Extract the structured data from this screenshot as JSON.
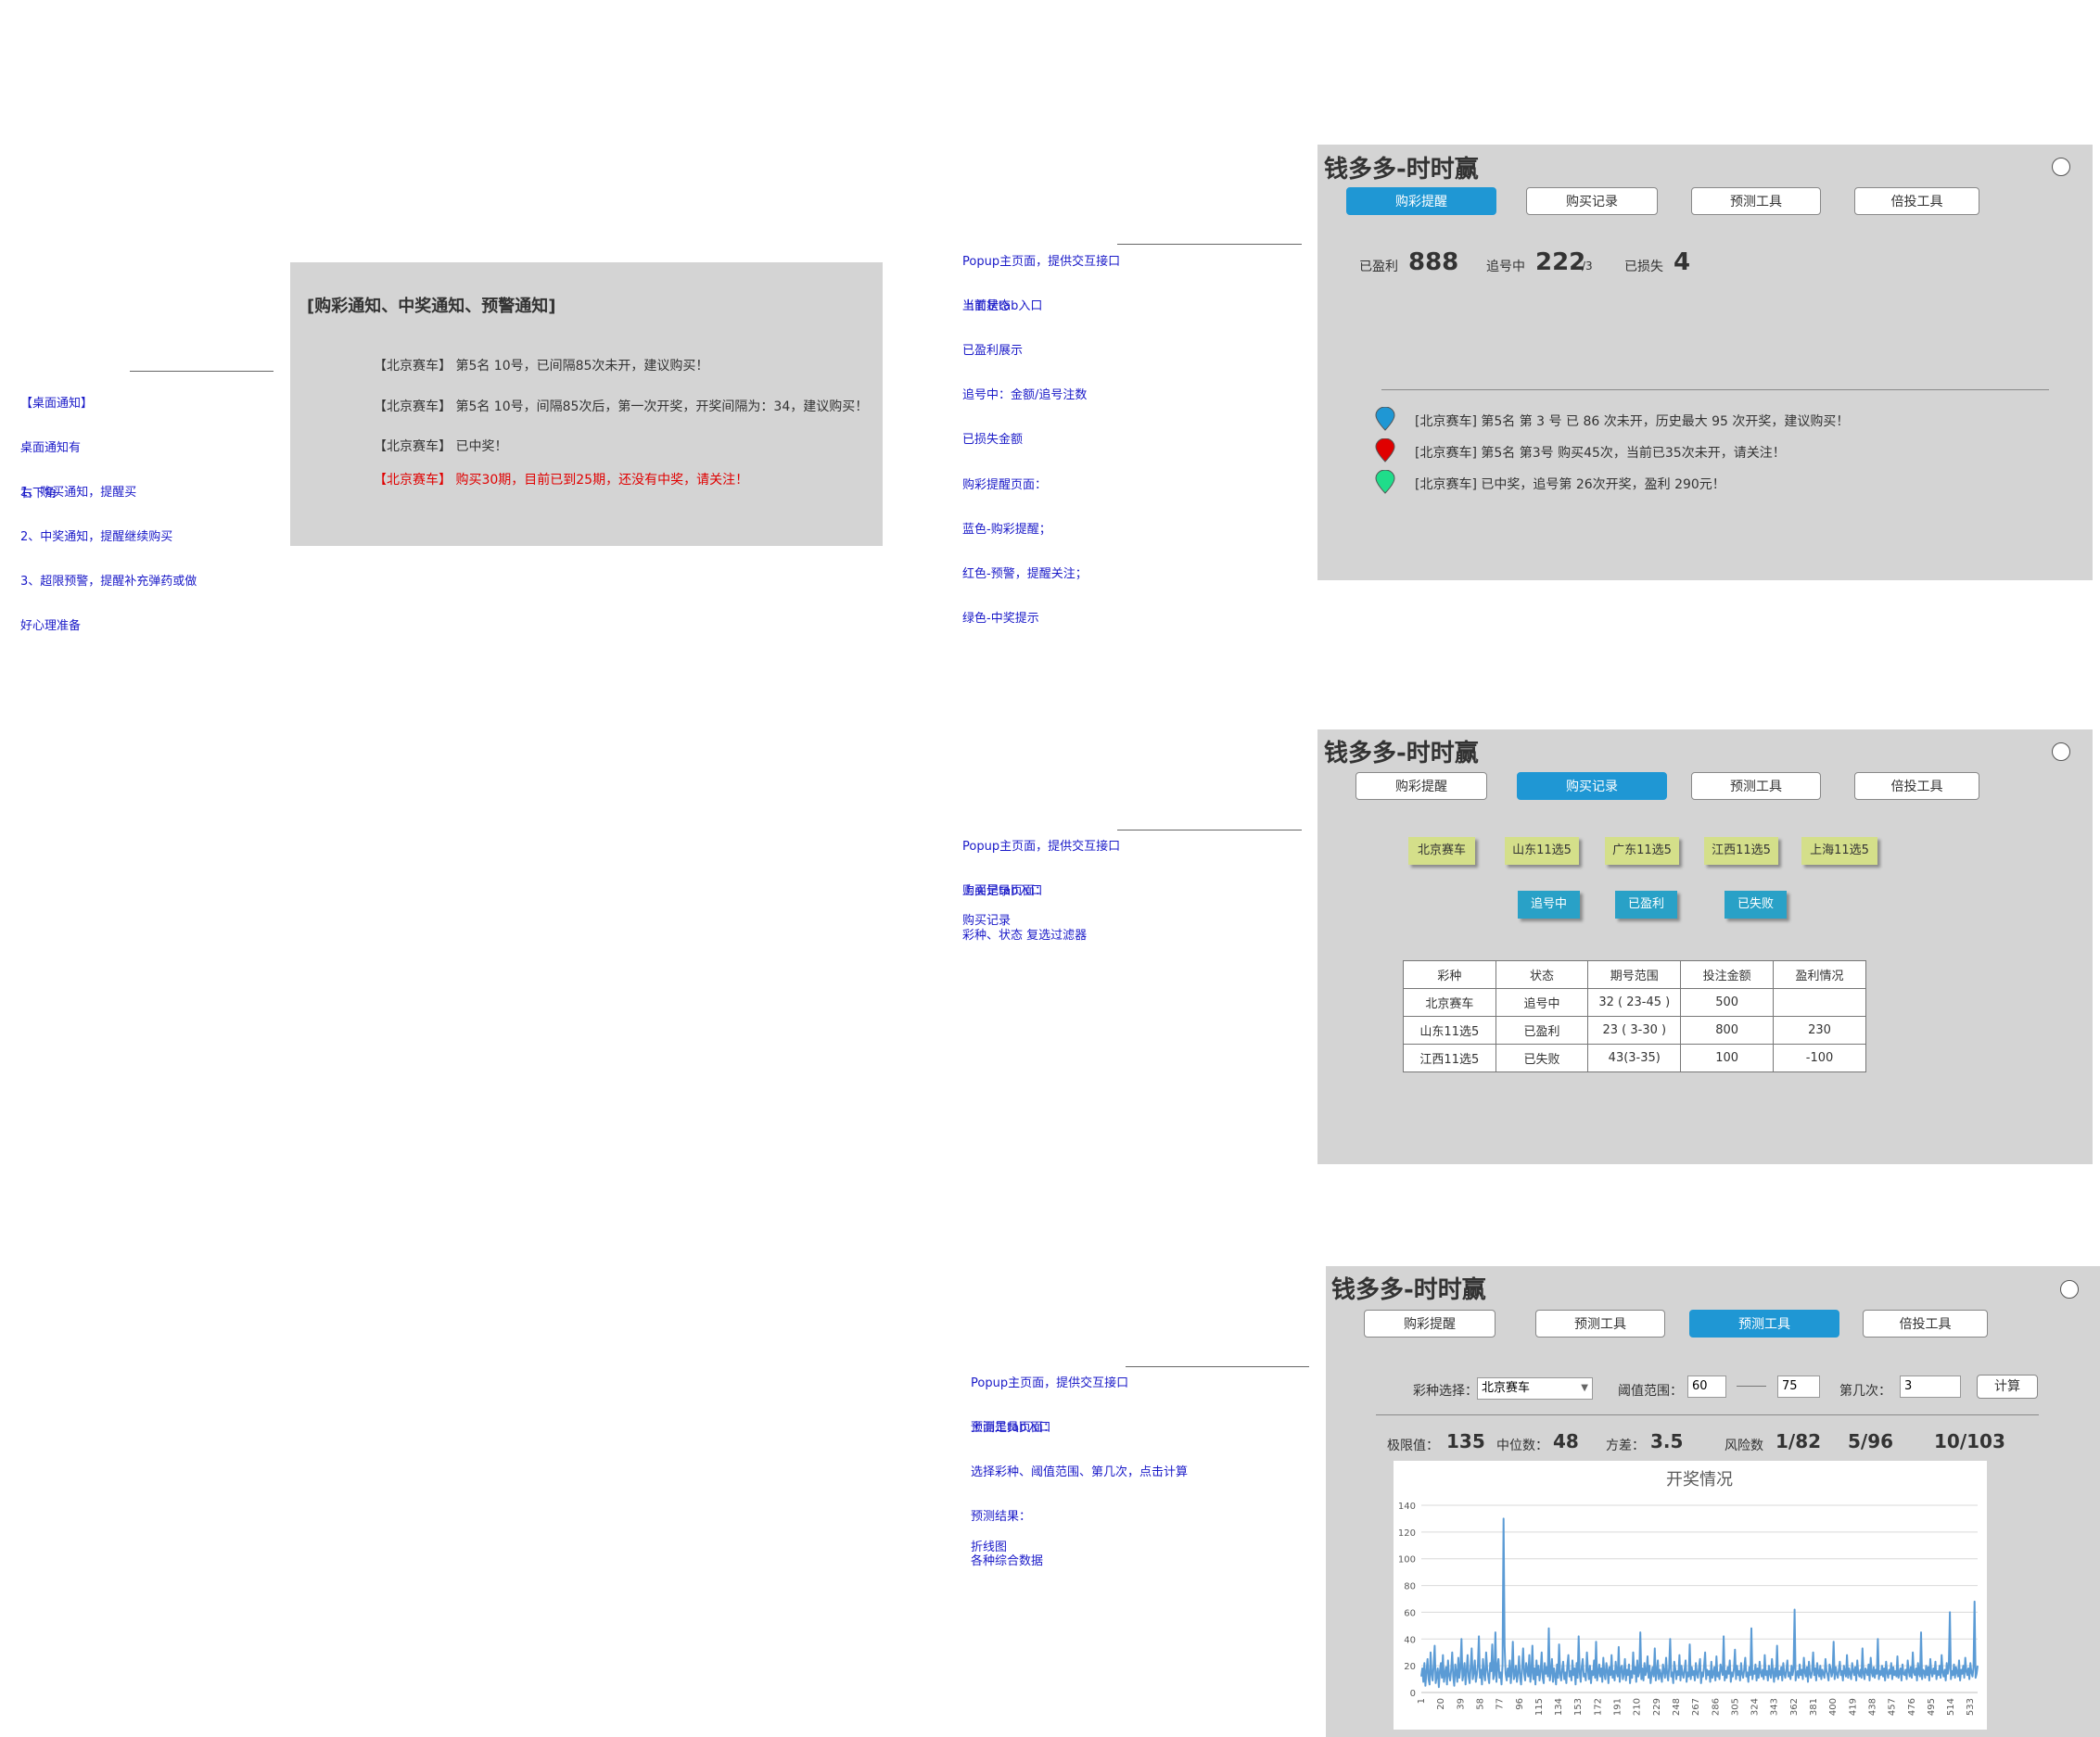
{
  "desktop_notes": {
    "lines": [
      "【桌面通知】",
      "桌面通知有",
      "1、购买通知，提醒买",
      "2、中奖通知，提醒继续购买",
      "3、超限预警，提醒补充弹药或做",
      "好心理准备"
    ],
    "corner": "右下角"
  },
  "notify_box": {
    "title": "[购彩通知、中奖通知、预警通知]",
    "messages": [
      "【北京赛车】 第5名 10号，已间隔85次未开，建议购买！",
      "【北京赛车】 第5名 10号，间隔85次后，第一次开奖，开奖间隔为：34，建议购买！",
      "【北京赛车】 已中奖！",
      "【北京赛车】 购买30期，目前已到25期，还没有中奖，请关注！"
    ]
  },
  "notes1": {
    "a": [
      "Popup主页面，提供交互接口",
      "上面是tab入口"
    ],
    "b": [
      "当前状态",
      "已盈利展示",
      "追号中：金额/追号注数",
      "已损失金额"
    ],
    "c": [
      "购彩提醒页面：",
      "蓝色-购彩提醒；",
      "红色-预警，提醒关注；",
      "绿色-中奖提示"
    ]
  },
  "notes2": {
    "a": [
      "Popup主页面，提供交互接口",
      "上面是tab入口"
    ],
    "b": [
      "购买记录页面：",
      "彩种、状态 复选过滤器"
    ],
    "c": "购买记录"
  },
  "notes3": {
    "a": [
      "Popup主页面，提供交互接口",
      "上面是tab入口"
    ],
    "b": [
      "预测工具页面：",
      "选择彩种、阈值范围、第几次，点击计算"
    ],
    "c": [
      "预测结果：",
      "各种综合数据"
    ],
    "d": "折线图"
  },
  "app_title": "钱多多-时时赢",
  "panel1": {
    "tabs": [
      "购彩提醒",
      "购买记录",
      "预测工具",
      "倍投工具"
    ],
    "stats": {
      "profit_label": "已盈利",
      "profit_value": "888",
      "chase_label": "追号中",
      "chase_value": "222",
      "chase_suffix": "/3",
      "loss_label": "已损失",
      "loss_value": "4"
    },
    "messages": [
      {
        "pin": "blue-pin-icon",
        "color": "#1f97d4",
        "text": "[北京赛车] 第5名 第 3 号 已 86 次未开，历史最大 95 次开奖，建议购买！"
      },
      {
        "pin": "red-pin-icon",
        "color": "#e00000",
        "text": "[北京赛车] 第5名 第3号 购买45次，当前已35次未开，请关注！"
      },
      {
        "pin": "green-pin-icon",
        "color": "#1fdd8a",
        "text": "[北京赛车] 已中奖，追号第 26次开奖，盈利 290元！"
      }
    ]
  },
  "panel2": {
    "tabs": [
      "购彩提醒",
      "购买记录",
      "预测工具",
      "倍投工具"
    ],
    "lottery_filters": [
      "北京赛车",
      "山东11选5",
      "广东11选5",
      "江西11选5",
      "上海11选5"
    ],
    "status_filters": [
      "追号中",
      "已盈利",
      "已失败"
    ],
    "table": {
      "headers": [
        "彩种",
        "状态",
        "期号范围",
        "投注金额",
        "盈利情况"
      ],
      "rows": [
        [
          "北京赛车",
          "追号中",
          "32 ( 23-45 )",
          "500",
          ""
        ],
        [
          "山东11选5",
          "已盈利",
          "23 ( 3-30 )",
          "800",
          "230"
        ],
        [
          "江西11选5",
          "已失败",
          "43(3-35)",
          "100",
          "-100"
        ]
      ]
    }
  },
  "panel3": {
    "tabs": [
      "购彩提醒",
      "预测工具",
      "预测工具",
      "倍投工具"
    ],
    "form": {
      "lottery_label": "彩种选择：",
      "lottery_value": "北京赛车",
      "threshold_label": "阈值范围：",
      "threshold_min": "60",
      "threshold_max": "75",
      "nth_label": "第几次：",
      "nth_value": "3",
      "calc_label": "计算"
    },
    "results": {
      "limit_label": "极限值：",
      "limit_value": "135",
      "median_label": "中位数：",
      "median_value": "48",
      "variance_label": "方差：",
      "variance_value": "3.5",
      "risk_label": "风险数",
      "risk_values": [
        "1/82",
        "5/96",
        "10/103"
      ]
    }
  },
  "chart_data": {
    "type": "line",
    "title": "开奖情况",
    "xlabel": "",
    "ylabel": "",
    "ylim": [
      0,
      140
    ],
    "y_ticks": [
      0,
      20,
      40,
      60,
      80,
      100,
      120,
      140
    ],
    "x_ticks": [
      1,
      20,
      39,
      58,
      77,
      96,
      115,
      134,
      153,
      172,
      191,
      210,
      229,
      248,
      267,
      286,
      305,
      324,
      343,
      362,
      381,
      400,
      419,
      438,
      457,
      476,
      495,
      514,
      533
    ],
    "grid": true,
    "color": "#5b9bd5",
    "x_range": [
      1,
      540
    ],
    "series": [
      {
        "values": [
          12,
          18,
          8,
          22,
          5,
          15,
          25,
          10,
          6,
          30,
          14,
          9,
          20,
          35,
          7,
          12,
          18,
          4,
          16,
          22,
          11,
          28,
          8,
          14,
          19,
          6,
          24,
          13,
          9,
          17,
          30,
          12,
          5,
          21,
          15,
          8,
          26,
          11,
          18,
          40,
          9,
          14,
          22,
          6,
          16,
          28,
          12,
          7,
          19,
          33,
          10,
          15,
          24,
          8,
          13,
          20,
          42,
          11,
          17,
          6,
          25,
          14,
          9,
          30,
          18,
          12,
          7,
          22,
          16,
          36,
          10,
          13,
          45,
          8,
          19,
          25,
          11,
          15,
          6,
          21,
          130,
          35,
          14,
          9,
          18,
          12,
          24,
          7,
          16,
          38,
          10,
          13,
          20,
          8,
          15,
          27,
          11,
          6,
          19,
          33,
          14,
          9,
          22,
          17,
          12,
          28,
          8,
          15,
          35,
          10,
          18,
          6,
          24,
          13,
          20,
          9,
          16,
          30,
          11,
          7,
          22,
          14,
          19,
          12,
          48,
          9,
          15,
          25,
          8,
          18,
          13,
          6,
          21,
          11,
          36,
          14,
          9,
          17,
          23,
          10,
          15,
          7,
          20,
          28,
          12,
          16,
          9,
          24,
          13,
          18,
          6,
          22,
          11,
          42,
          15,
          8,
          19,
          25,
          12,
          14,
          9,
          30,
          17,
          10,
          20,
          7,
          16,
          13,
          24,
          11,
          38,
          9,
          15,
          21,
          12,
          18,
          8,
          26,
          14,
          10,
          22,
          17,
          7,
          19,
          13,
          28,
          11,
          16,
          9,
          23,
          15,
          12,
          34,
          8,
          18,
          20,
          10,
          14,
          25,
          9,
          17,
          13,
          21,
          7,
          16,
          11,
          30,
          14,
          19,
          8,
          24,
          12,
          15,
          45,
          10,
          18,
          9,
          22,
          13,
          16,
          27,
          11,
          20,
          7,
          14,
          19,
          12,
          33,
          9,
          15,
          24,
          10,
          17,
          13,
          8,
          21,
          16,
          11,
          26,
          14,
          9,
          19,
          40,
          12,
          15,
          7,
          23,
          18,
          10,
          16,
          13,
          28,
          9,
          20,
          14,
          11,
          17,
          24,
          8,
          15,
          12,
          36,
          10,
          19,
          13,
          16,
          9,
          22,
          14,
          11,
          18,
          25,
          7,
          15,
          12,
          20,
          30,
          10,
          17,
          13,
          16,
          8,
          23,
          11,
          14,
          19,
          9,
          27,
          12,
          15,
          10,
          21,
          17,
          13,
          42,
          9,
          16,
          11,
          19,
          14,
          24,
          8,
          15,
          12,
          18,
          32,
          10,
          20,
          13,
          16,
          9,
          22,
          14,
          11,
          17,
          26,
          12,
          15,
          8,
          19,
          13,
          48,
          10,
          16,
          14,
          21,
          9,
          18,
          11,
          23,
          15,
          12,
          17,
          10,
          28,
          13,
          16,
          9,
          20,
          14,
          11,
          25,
          15,
          8,
          18,
          12,
          35,
          10,
          16,
          13,
          19,
          9,
          22,
          14,
          11,
          17,
          24,
          12,
          15,
          10,
          20,
          13,
          18,
          62,
          9,
          14,
          16,
          11,
          21,
          13,
          17,
          10,
          26,
          15,
          12,
          19,
          8,
          23,
          14,
          11,
          16,
          30,
          13,
          18,
          9,
          22,
          15,
          12,
          20,
          10,
          17,
          14,
          11,
          25,
          16,
          13,
          9,
          21,
          18,
          12,
          15,
          38,
          10,
          19,
          14,
          11,
          17,
          23,
          13,
          16,
          9,
          20,
          15,
          12,
          28,
          11,
          18,
          14,
          10,
          22,
          16,
          13,
          19,
          9,
          24,
          15,
          12,
          17,
          11,
          33,
          14,
          10,
          18,
          16,
          13,
          21,
          9,
          26,
          15,
          12,
          19,
          11,
          17,
          14,
          40,
          10,
          16,
          13,
          20,
          12,
          18,
          9,
          23,
          15,
          11,
          17,
          14,
          22,
          10,
          19,
          13,
          16,
          12,
          27,
          11,
          15,
          18,
          9,
          21,
          14,
          13,
          17,
          10,
          24,
          16,
          12,
          19,
          11,
          30,
          15,
          13,
          18,
          9,
          22,
          14,
          12,
          45,
          10,
          17,
          16,
          11,
          20,
          13,
          19,
          9,
          25,
          15,
          12,
          18,
          14,
          23,
          10,
          16,
          13,
          20,
          11,
          28,
          15,
          12,
          17,
          9,
          22,
          14,
          18,
          60,
          10,
          16,
          13,
          21,
          11,
          19,
          15,
          12,
          24,
          9,
          17,
          14,
          20,
          11,
          26,
          16,
          13,
          18,
          10,
          22,
          15,
          12,
          19,
          68,
          11,
          14,
          20
        ]
      }
    ]
  }
}
